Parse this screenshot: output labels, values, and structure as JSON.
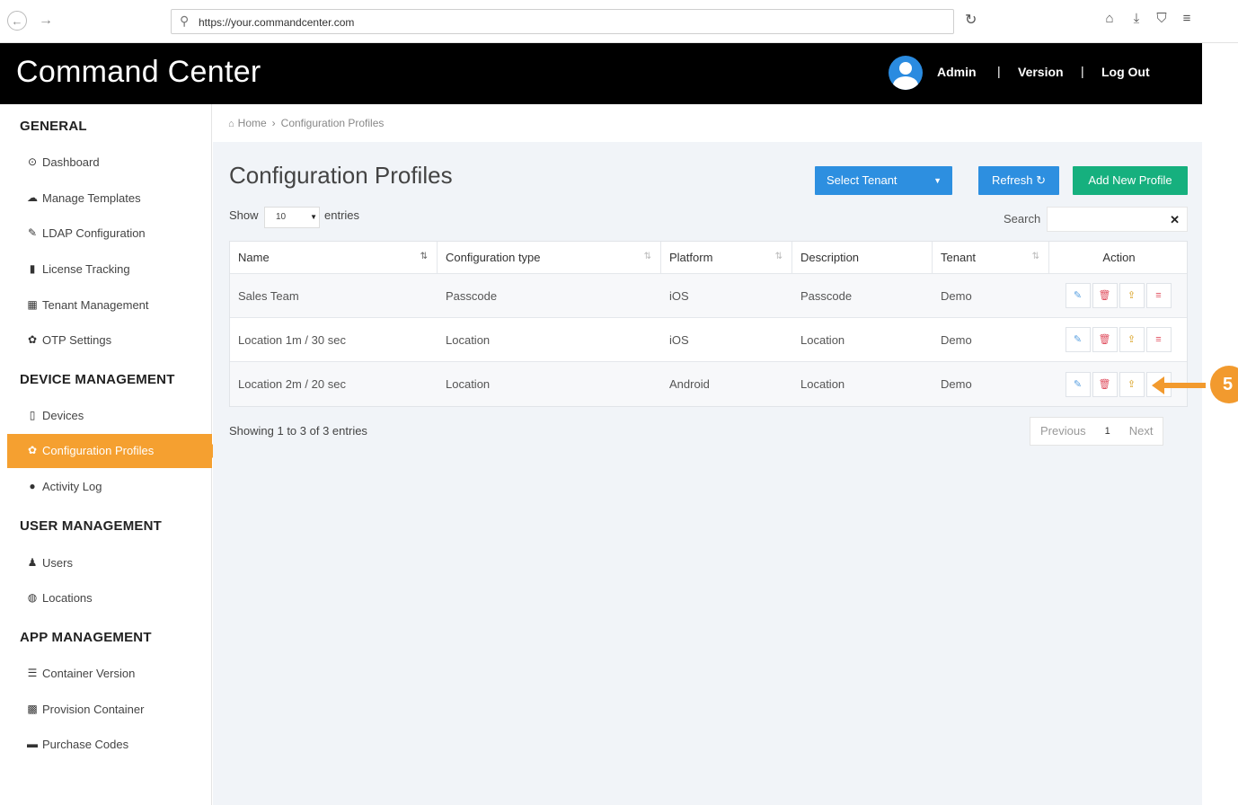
{
  "browser": {
    "url": "https://your.commandcenter.com",
    "back_icon": "back-arrow-icon",
    "forward_icon": "forward-arrow-icon"
  },
  "header": {
    "title": "Command Center",
    "admin": "Admin",
    "version": "Version",
    "logout": "Log Out",
    "sep": "|"
  },
  "sidebar": {
    "sections": [
      {
        "heading": "GENERAL"
      },
      {
        "heading": "DEVICE MANAGEMENT"
      },
      {
        "heading": "USER MANAGEMENT"
      },
      {
        "heading": "APP MANAGEMENT"
      }
    ],
    "items": [
      {
        "label": "Dashboard",
        "icon": "⊙"
      },
      {
        "label": "Manage Templates",
        "icon": "☁"
      },
      {
        "label": "LDAP Configuration",
        "icon": "✎"
      },
      {
        "label": "License Tracking",
        "icon": "▮"
      },
      {
        "label": "Tenant Management",
        "icon": "▦"
      },
      {
        "label": "OTP Settings",
        "icon": "✿"
      },
      {
        "label": "Devices",
        "icon": "▯"
      },
      {
        "label": "Configuration Profiles",
        "icon": "✿"
      },
      {
        "label": "Activity Log",
        "icon": "●"
      },
      {
        "label": "Users",
        "icon": "♟"
      },
      {
        "label": "Locations",
        "icon": "◍"
      },
      {
        "label": "Container Version",
        "icon": "☰"
      },
      {
        "label": "Provision Container",
        "icon": "▩"
      },
      {
        "label": "Purchase Codes",
        "icon": "▬"
      }
    ]
  },
  "breadcrumb": {
    "home_icon": "⌂",
    "home": "Home",
    "sep": "›",
    "current": "Configuration Profiles"
  },
  "page": {
    "title": "Configuration Profiles",
    "select_tenant": "Select Tenant",
    "refresh": "Refresh ↻",
    "add_profile": "Add New Profile",
    "show": "Show",
    "page_length": "10",
    "entries": "entries",
    "search_label": "Search",
    "search_value": "",
    "clear_glyph": "✕"
  },
  "table": {
    "columns": [
      "Name",
      "Configuration type",
      "Platform",
      "Description",
      "Tenant",
      "Action"
    ],
    "rows": [
      {
        "name": "Sales Team",
        "type": "Passcode",
        "platform": "iOS",
        "description": "Passcode",
        "tenant": "Demo"
      },
      {
        "name": "Location 1m / 30 sec",
        "type": "Location",
        "platform": "iOS",
        "description": "Location",
        "tenant": "Demo"
      },
      {
        "name": "Location 2m / 20 sec",
        "type": "Location",
        "platform": "Android",
        "description": "Location",
        "tenant": "Demo"
      }
    ],
    "showing": "Showing 1 to 3 of 3 entries"
  },
  "pager": {
    "previous": "Previous",
    "current": "1",
    "next": "Next"
  },
  "callout": {
    "number": "5",
    "color": "#f29a2e"
  },
  "colors": {
    "accent_orange": "#f5a030",
    "button_blue": "#2d8fe0",
    "button_green": "#16b07e",
    "header_black": "#000000"
  }
}
